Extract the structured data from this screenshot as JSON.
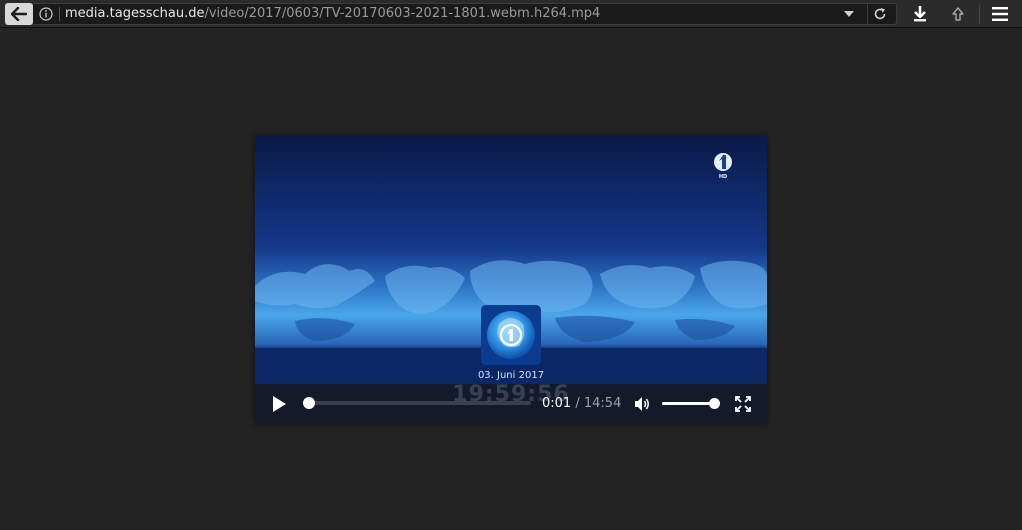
{
  "toolbar": {
    "url_domain": "media.tagesschau.de",
    "url_path": "/video/2017/0603/TV-20170603-2021-1801.webm.h264.mp4"
  },
  "icons": {
    "back": "back-arrow-icon",
    "info": "info-icon",
    "dropdown": "chevron-down-icon",
    "reload": "reload-icon",
    "download": "download-icon",
    "upload": "upload-icon",
    "menu": "hamburger-menu-icon",
    "play": "play-icon",
    "volume": "speaker-icon",
    "fullscreen": "fullscreen-icon",
    "channel_logo": "ard-one-logo-icon"
  },
  "video": {
    "channel_badge": "HD",
    "date": "03. Juni 2017",
    "overlay_clock": "19:59:56"
  },
  "player": {
    "current_time": "0:01",
    "separator": "/",
    "total_time": "14:54",
    "progress_fraction": 0.001,
    "volume_fraction": 1.0
  },
  "colors": {
    "page_background": "#232323",
    "video_sky": "#0c1e4c",
    "controls_background": "#141a2a"
  }
}
